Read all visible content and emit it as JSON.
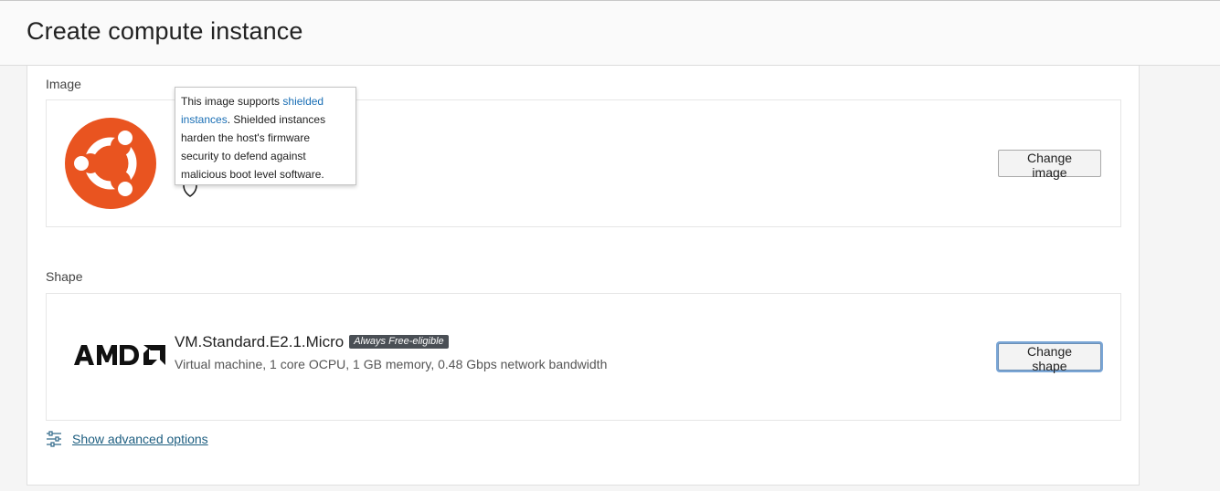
{
  "header": {
    "title": "Create compute instance"
  },
  "image_section": {
    "label": "Image",
    "logo_icon": "ubuntu-logo-icon",
    "change_button": "Change image",
    "tooltip": {
      "prefix": "This image supports ",
      "link": "shielded instances",
      "suffix": ". Shielded instances harden the host's firmware security to defend against malicious boot level software."
    }
  },
  "shape_section": {
    "label": "Shape",
    "logo_icon": "amd-logo-icon",
    "shape_name": "VM.Standard.E2.1.Micro",
    "badge": "Always Free-eligible",
    "description": "Virtual machine, 1 core OCPU, 1 GB memory, 0.48 Gbps network bandwidth",
    "change_button": "Change shape"
  },
  "advanced": {
    "link_text": "Show advanced options",
    "icon": "sliders-icon"
  },
  "colors": {
    "ubuntu_orange": "#E95420",
    "link_blue": "#1a6fb5",
    "badge_bg": "#4a4f55",
    "focus_ring": "#7aa6d6"
  }
}
